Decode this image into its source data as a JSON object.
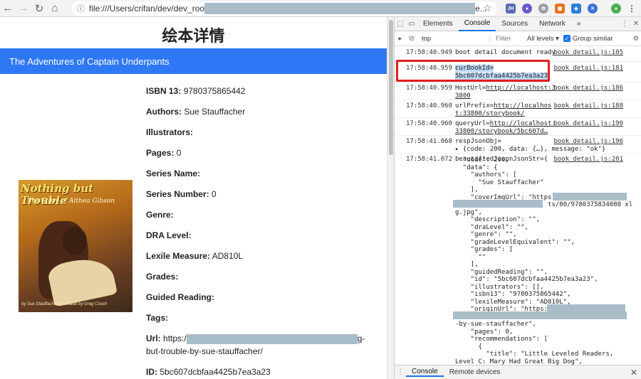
{
  "browser": {
    "url_prefix": "file:///Users/crifan/dev/dev_roo",
    "url_suffix": "e..."
  },
  "page": {
    "title": "绘本详情",
    "book_name": "The Adventures of Captain Underpants",
    "cover": {
      "title": "Nothing but Trouble",
      "subtitle": "The Story of Althea Gibson",
      "credit": "by Sue Stauffacher   illustrated by Greg Couch"
    },
    "fields": [
      {
        "label": "ISBN 13:",
        "value": "9780375865442"
      },
      {
        "label": "Authors:",
        "value": "Sue Stauffacher"
      },
      {
        "label": "Illustrators:",
        "value": ""
      },
      {
        "label": "Pages:",
        "value": "0"
      },
      {
        "label": "Series Name:",
        "value": ""
      },
      {
        "label": "Series Number:",
        "value": "0"
      },
      {
        "label": "Genre:",
        "value": ""
      },
      {
        "label": "DRA Level:",
        "value": ""
      },
      {
        "label": "Lexile Measure:",
        "value": "AD810L"
      },
      {
        "label": "Grades:",
        "value": ""
      },
      {
        "label": "Guided Reading:",
        "value": ""
      },
      {
        "label": "Tags:",
        "value": ""
      },
      {
        "label": "Url:",
        "value": "https:/",
        "value_end": "g-"
      },
      {
        "label": "",
        "value": "but-trouble-by-sue-stauffacher/"
      },
      {
        "label": "ID:",
        "value": "5bc607dcbfaa4425b7ea3a23"
      }
    ]
  },
  "devtools": {
    "tabs": [
      "Elements",
      "Console",
      "Sources",
      "Network"
    ],
    "active_tab": "Console",
    "more": "»",
    "context": "top",
    "filter_placeholder": "Filter",
    "levels": "All levels ▾",
    "group_similar": "Group similar",
    "logs": [
      {
        "time": "17:58:40.949",
        "msg": "boot detail document ready",
        "src": "book_detail.js:105"
      },
      {
        "time": "17:58:40.959",
        "msg1": "curBookId=",
        "msg2": "5bc607dcbfaa4425b7ea3a23",
        "src": "book_detail.js:181"
      },
      {
        "time": "17:58:40.959",
        "msg1": "HostUrl=",
        "msg_link": "http://localhost:3",
        "msg2": "3800",
        "src": "book_detail.js:186"
      },
      {
        "time": "17:58:40.960",
        "msg1": "urlPrefix=",
        "msg_link": "http://localhos",
        "msg2": "t:33800/storybook/",
        "src": "book_detail.js:188"
      },
      {
        "time": "17:58:40.960",
        "msg1": "queryUrl=",
        "msg_link": "http://localhost:",
        "msg2": "33800/storybook/5bc607d…",
        "src": "book_detail.js:190"
      },
      {
        "time": "17:58:41.068",
        "msg1": "respJsonObj=",
        "msg2": "▸ {code: 200, data: {…}, message: \"ok\"}",
        "src": "book_detail.js:196"
      },
      {
        "time": "17:58:41.072",
        "msg1": "beautifiedJespnJsonStr={",
        "src": "book_detail.js:201"
      }
    ],
    "json_lines": [
      "  \"code\": 200,",
      "  \"data\": {",
      "    \"authors\": [",
      "      \"Sue Stauffacher\"",
      "    ],",
      "    \"coverImgUrl\": \"https:",
      "                        ts/80/9780375834080 xl",
      "g.jpg\",",
      "    \"description\": \"\",",
      "    \"draLevel\": \"\",",
      "    \"genre\": \"\",",
      "    \"gradeLevelEquivalent\": \"\",",
      "    \"grades\": [",
      "      \"\"",
      "    ],",
      "    \"guidedReading\": \"\",",
      "    \"id\": \"5bc607dcbfaa4425b7ea3a23\",",
      "    \"illustrators\": [],",
      "    \"isbn13\": \"9780375865442\",",
      "    \"lexileMeasure\": \"AD810L\",",
      "    \"originUrl\": \"https:",
      "",
      "-by-sue-stauffacher\",",
      "    \"pages\": 0,",
      "    \"recommendations\": [",
      "      {",
      "        \"title\": \"Little Leveled Readers,",
      "Level C: Mary Had Great Big Dog\","
    ],
    "bottom_tabs": [
      "Console",
      "Remote devices"
    ]
  }
}
